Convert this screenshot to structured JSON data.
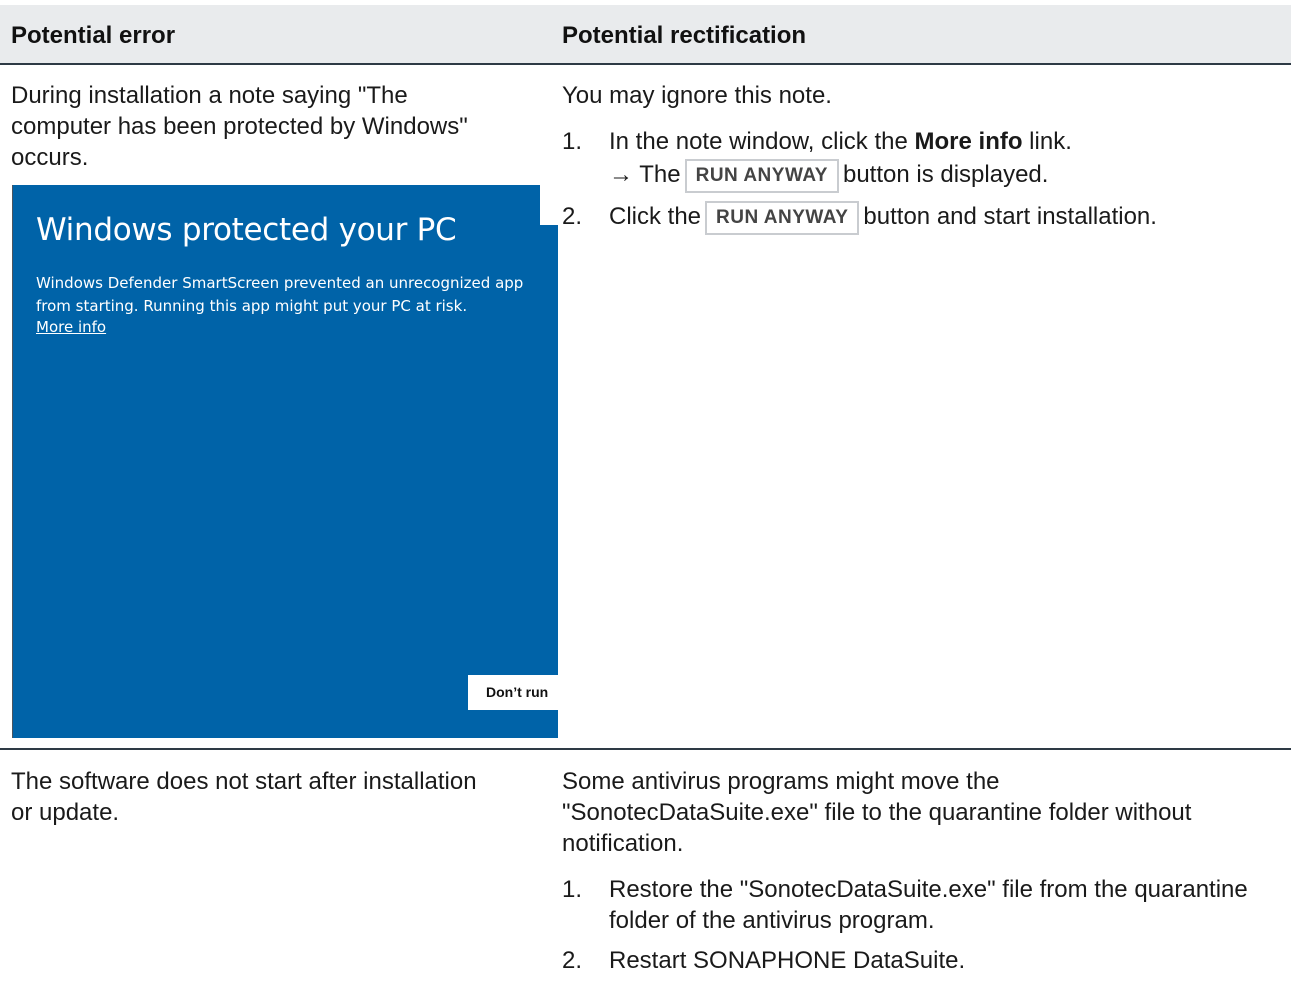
{
  "header": {
    "col1": "Potential error",
    "col2": "Potential rectification"
  },
  "rows": [
    {
      "error": "During installation a note saying \"The computer has been protected by Windows\" occurs.",
      "intro": "You may ignore this note.",
      "steps": [
        {
          "num": "1.",
          "pre": "In the note window, click the ",
          "bold": "More info",
          "post": " link.",
          "result_pre": "→ The",
          "button": "RUN ANYWAY",
          "result_post": "button is displayed."
        },
        {
          "num": "2.",
          "pre": "Click the",
          "button": "RUN ANYWAY",
          "post": "button and start installation."
        }
      ],
      "dialog": {
        "title": "Windows protected your PC",
        "message": "Windows Defender SmartScreen prevented an unrecognized app from starting. Running this app might put your PC at risk.",
        "link": "More info",
        "button": "Don’t run",
        "bg_color": "#0063a8"
      }
    },
    {
      "error": "The software does not start after installation or update.",
      "intro": "Some antivirus programs might move the \"SonotecDataSuite.exe\" file to the quarantine folder without notification.",
      "steps": [
        {
          "num": "1.",
          "text": "Restore the \"SonotecDataSuite.exe\" file from the quarantine folder of the antivirus program."
        },
        {
          "num": "2.",
          "text": "Restart SONAPHONE DataSuite."
        }
      ]
    }
  ]
}
